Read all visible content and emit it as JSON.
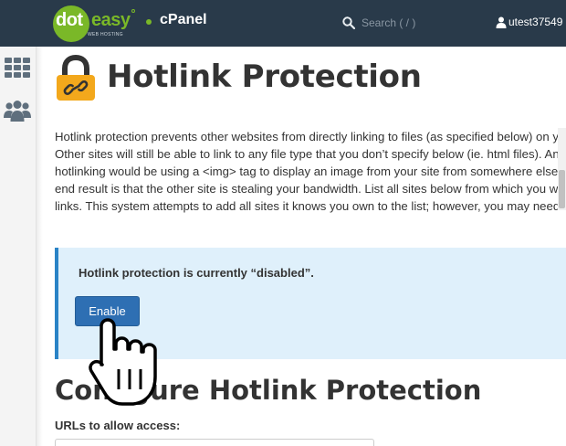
{
  "header": {
    "logo": {
      "dot": "dot",
      "easy": "easy",
      "tagline": "WEB HOSTING"
    },
    "brand": "cPanel",
    "search_placeholder": "Search ( / )",
    "username": "utest37549"
  },
  "sidebar": {
    "items": [
      {
        "icon": "apps-grid-icon"
      },
      {
        "icon": "users-icon"
      }
    ]
  },
  "main": {
    "title": "Hotlink Protection",
    "description_lines": [
      "Hotlink protection prevents other websites from directly linking to files (as specified below) on your website.",
      "Other sites will still be able to link to any file type that you don’t specify below (ie. html files). An example of",
      "hotlinking would be using a <img> tag to display an image from your site from somewhere else on the net. The",
      "end result is that the other site is stealing your bandwidth. List all sites below from which you wish to allow direct",
      "links. This system attempts to add all sites it knows you own to the list; however, you may need to add others."
    ],
    "status_text": "Hotlink protection is currently “disabled”.",
    "enable_label": "Enable",
    "section_title": "Configure Hotlink Protection",
    "urls_label": "URLs to allow access:"
  },
  "colors": {
    "navbar": "#293a4a",
    "brand_green": "#7ab828",
    "info_bg": "#dff0fb",
    "info_border": "#2a83c6",
    "button": "#2e6fb3"
  }
}
